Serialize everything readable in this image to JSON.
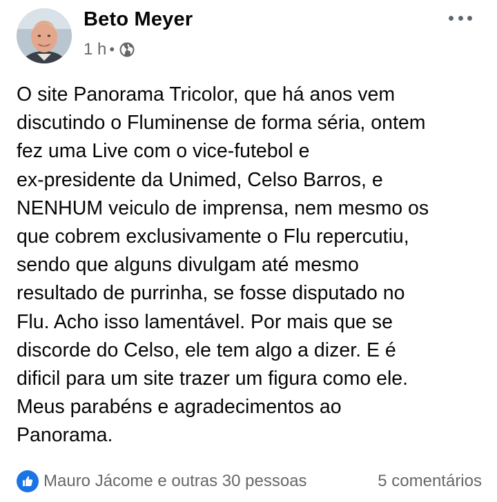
{
  "post": {
    "author_name": "Beto Meyer",
    "timestamp": "1 h",
    "separator": "•",
    "privacy_icon": "globe-icon",
    "more_icon": "more-horizontal-icon",
    "text": "O site Panorama Tricolor, que há anos vem\ndiscutindo o Fluminense de forma séria, ontem\nfez uma Live com o vice-futebol e\nex-presidente da Unimed, Celso Barros, e\nNENHUM veiculo de imprensa, nem mesmo os\nque cobrem exclusivamente o Flu repercutiu,\nsendo que alguns divulgam até mesmo\nresultado de purrinha, se fosse disputado no\nFlu. Acho isso lamentável. Por mais que se\ndiscorde do Celso, ele tem algo a dizer. E é\ndificil para um site trazer um figura como ele.\nMeus parabéns e agradecimentos ao\nPanorama."
  },
  "footer": {
    "reaction_icon": "like-icon",
    "reactions_text": "Mauro Jácome e outras 30 pessoas",
    "comments_text": "5 comentários"
  },
  "colors": {
    "text_primary": "#050505",
    "text_secondary": "#65676b",
    "like_blue": "#1b74e4"
  }
}
